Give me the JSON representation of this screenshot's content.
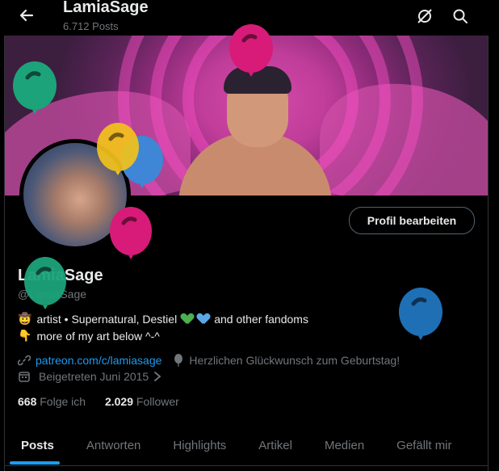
{
  "header": {
    "title": "LamiaSage",
    "subtitle": "6.712 Posts",
    "back_icon": "arrow-left-icon",
    "icons": [
      "grok-icon",
      "search-icon"
    ]
  },
  "profile": {
    "display_name": "LamiaSage",
    "handle": "@LamiaSage",
    "edit_button": "Profil bearbeiten",
    "bio_line1_prefix": "artist • Supernatural, Destiel",
    "bio_line1_suffix": "and other fandoms",
    "bio_line2": "more of my art below ^-^",
    "link": "patreon.com/c/lamiasage",
    "birthday": "Herzlichen Glückwunsch zum Geburtstag!",
    "joined": "Beigetreten Juni 2015",
    "following_count": "668",
    "following_label": "Folge ich",
    "followers_count": "2.029",
    "followers_label": "Follower"
  },
  "tabs": [
    "Posts",
    "Antworten",
    "Highlights",
    "Artikel",
    "Medien",
    "Gefällt mir"
  ],
  "active_tab": "Posts",
  "colors": {
    "accent": "#1d9bf0",
    "background": "#000000",
    "balloon_pink": "#d81b78",
    "balloon_green": "#1ca37a",
    "balloon_blue": "#1f6fb5",
    "balloon_yellow": "#f2c21b"
  }
}
